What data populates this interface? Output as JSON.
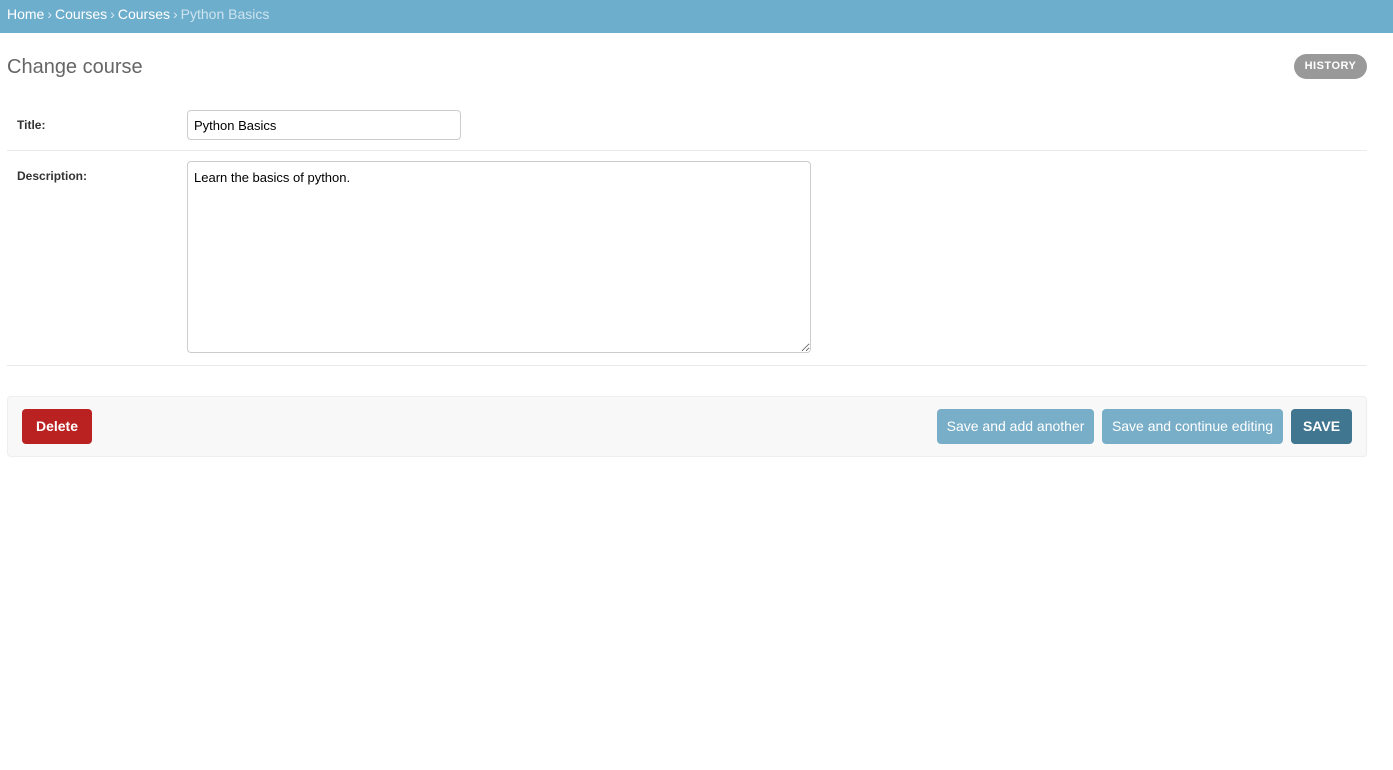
{
  "breadcrumbs": {
    "items": [
      "Home",
      "Courses",
      "Courses"
    ],
    "separator": "›",
    "current": "Python Basics"
  },
  "page": {
    "title": "Change course",
    "history_label": "HISTORY"
  },
  "form": {
    "title_label": "Title:",
    "title_value": "Python Basics",
    "description_label": "Description:",
    "description_value": "Learn the basics of python."
  },
  "actions": {
    "delete_label": "Delete",
    "save_add_another_label": "Save and add another",
    "save_continue_label": "Save and continue editing",
    "save_label": "SAVE"
  },
  "colors": {
    "header": "#6eaecd",
    "delete": "#ba2121",
    "secondary_button": "#79aec8",
    "primary_button": "#417690",
    "history_button": "#999999"
  }
}
